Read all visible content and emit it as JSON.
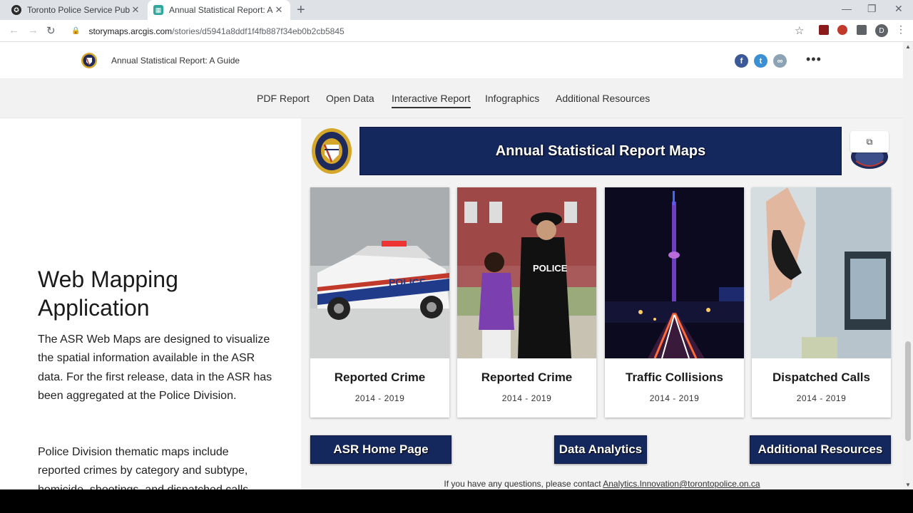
{
  "browser": {
    "tabs": [
      {
        "title": "Toronto Police Service Public Safe",
        "active": false
      },
      {
        "title": "Annual Statistical Report: A Guide",
        "active": true
      }
    ],
    "new_tab": "+",
    "url_domain": "storymaps.arcgis.com",
    "url_path": "/stories/d5941a8ddf1f4fb887f34eb0b2cb5845",
    "profile_initial": "D"
  },
  "header": {
    "story_title": "Annual Statistical Report: A Guide",
    "share_icons": [
      "facebook-icon",
      "twitter-icon",
      "link-icon"
    ]
  },
  "nav": {
    "items": [
      {
        "label": "PDF Report",
        "active": false
      },
      {
        "label": "Open Data",
        "active": false
      },
      {
        "label": "Interactive Report",
        "active": true
      },
      {
        "label": "Infographics",
        "active": false
      },
      {
        "label": "Additional Resources",
        "active": false
      }
    ]
  },
  "left": {
    "title": "Web Mapping Application",
    "paragraph1": "The ASR Web Maps are designed to visualize the spatial information available in the ASR data. For the first release, data in the ASR has been aggregated at the Police Division.",
    "paragraph2": "Police Division thematic maps include reported crimes by category and subtype, homicide, shootings, and dispatched calls"
  },
  "embed": {
    "banner_title": "Annual Statistical Report Maps",
    "cards": [
      {
        "title": "Reported Crime",
        "years": "2014 - 2019",
        "image": "police-car"
      },
      {
        "title": "Reported Crime",
        "years": "2014 - 2019",
        "image": "police-officer"
      },
      {
        "title": "Traffic Collisions",
        "years": "2014 - 2019",
        "image": "cn-tower-night"
      },
      {
        "title": "Dispatched Calls",
        "years": "2014 - 2019",
        "image": "dispatcher-phone"
      }
    ],
    "buttons": {
      "home": "ASR Home Page",
      "analytics": "Data Analytics",
      "resources": "Additional Resources"
    },
    "contact_text": "If you have any questions, please contact ",
    "contact_email": "Analytics.Innovation@torontopolice.on.ca"
  },
  "colors": {
    "banner": "#15285e",
    "nav_bg": "#f2f2f2",
    "embed_bg": "#f3f3f3"
  }
}
